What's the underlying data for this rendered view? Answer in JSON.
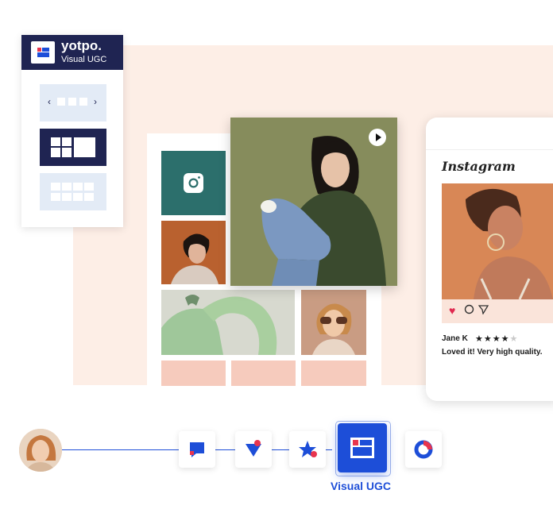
{
  "panel": {
    "brand": "yotpo.",
    "product": "Visual UGC",
    "layouts": [
      "carousel-layout",
      "tiles-layout",
      "grid-layout"
    ],
    "selected_layout": "tiles-layout",
    "carousel_prev": "‹",
    "carousel_next": "›"
  },
  "instagram_card": {
    "title": "Instagram",
    "reviewer": "Jane K",
    "rating": 4,
    "rating_max": 5,
    "stars_filled": "★★★★",
    "stars_empty": "★",
    "review_text": "Loved it! Very high quality."
  },
  "flow": {
    "active_label": "Visual UGC"
  },
  "colors": {
    "navy": "#1f2452",
    "brand_blue": "#1d4ed8",
    "accent_red": "#e8344e",
    "peach_bg": "#fdeee6",
    "teal": "#2c6f6c"
  },
  "icons": [
    "yotpo-logo-icon",
    "instagram-icon",
    "play-icon",
    "heart-icon",
    "comment-icon",
    "share-icon",
    "bookmark-icon",
    "reviews-icon",
    "loyalty-icon",
    "referrals-icon",
    "visual-ugc-icon",
    "analytics-icon"
  ]
}
